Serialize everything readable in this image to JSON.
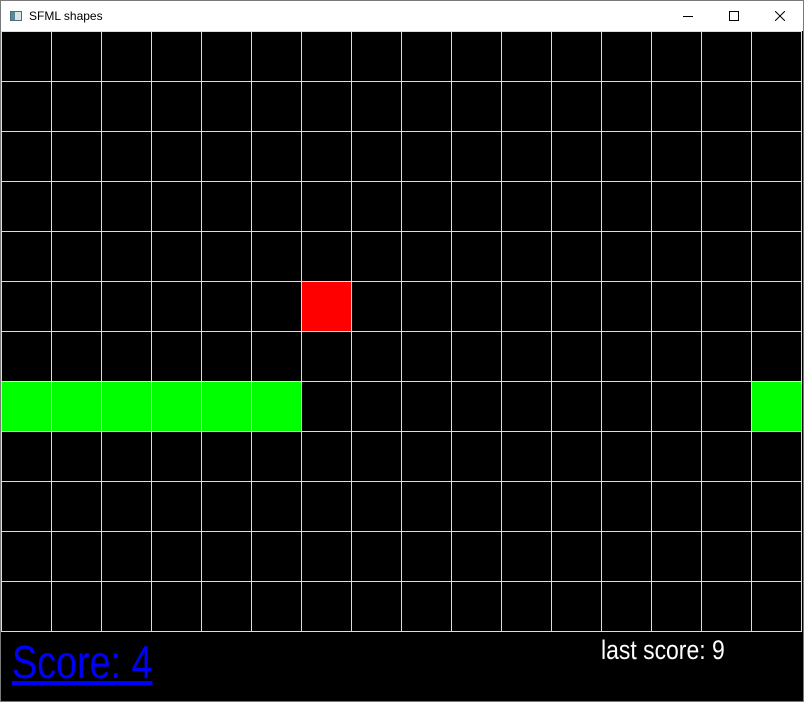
{
  "window": {
    "title": "SFML shapes",
    "icon": "app-window-icon",
    "controls": [
      "minimize-icon",
      "maximize-icon",
      "close-icon"
    ]
  },
  "board": {
    "columns": 16,
    "rows": 12,
    "background_color": "#000000",
    "grid_color": "#ffffff",
    "snake_color": "#00ff00",
    "food_color": "#ff0000",
    "snake_cells": [
      {
        "col": 0,
        "row": 7
      },
      {
        "col": 1,
        "row": 7
      },
      {
        "col": 2,
        "row": 7
      },
      {
        "col": 3,
        "row": 7
      },
      {
        "col": 4,
        "row": 7
      },
      {
        "col": 5,
        "row": 7
      },
      {
        "col": 15,
        "row": 7
      }
    ],
    "food_cell": {
      "col": 6,
      "row": 5
    }
  },
  "hud": {
    "score_label": "Score: 4",
    "score_color": "#0000ff",
    "last_score_label": "last score: 9",
    "last_score_color": "#ffffff"
  }
}
